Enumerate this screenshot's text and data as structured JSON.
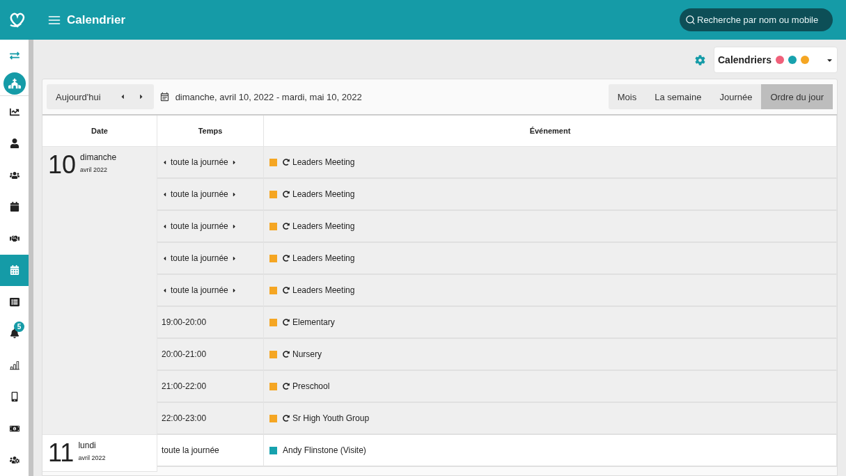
{
  "header": {
    "title": "Calendrier",
    "search": {
      "placeholder": "Recherche par nom ou mobile"
    }
  },
  "sidebar": {
    "items": [
      {
        "selected": false
      },
      {
        "kind": "avatar",
        "selected": false
      },
      {
        "selected": false
      },
      {
        "selected": false
      },
      {
        "selected": false
      },
      {
        "selected": false
      },
      {
        "selected": false
      },
      {
        "selected": true
      },
      {
        "selected": false
      },
      {
        "selected": false,
        "badge": "5"
      },
      {
        "selected": false
      },
      {
        "selected": false
      },
      {
        "selected": false
      },
      {
        "selected": false
      }
    ]
  },
  "calendars": {
    "label": "Calendriers",
    "dots": [
      {
        "color": "#f0607a"
      },
      {
        "color": "#17a2ae"
      },
      {
        "color": "#f5a623"
      }
    ]
  },
  "toolbar": {
    "today": "Aujourd'hui",
    "range": "dimanche, avril 10, 2022 - mardi, mai 10, 2022",
    "views": [
      {
        "label": "Mois",
        "selected": false
      },
      {
        "label": "La semaine",
        "selected": false
      },
      {
        "label": "Journée",
        "selected": false
      },
      {
        "label": "Ordre du jour",
        "selected": true
      }
    ]
  },
  "table": {
    "columns": [
      "Date",
      "Temps",
      "Événement"
    ],
    "days": [
      {
        "day": "10",
        "weekday": "dimanche",
        "month": "avril 2022",
        "highlighted": true,
        "events": [
          {
            "time": "toute la journée",
            "continues": true,
            "title": "Leaders Meeting",
            "recurring": true,
            "color": "#f5a623"
          },
          {
            "time": "toute la journée",
            "continues": true,
            "title": "Leaders Meeting",
            "recurring": true,
            "color": "#f5a623"
          },
          {
            "time": "toute la journée",
            "continues": true,
            "title": "Leaders Meeting",
            "recurring": true,
            "color": "#f5a623"
          },
          {
            "time": "toute la journée",
            "continues": true,
            "title": "Leaders Meeting",
            "recurring": true,
            "color": "#f5a623"
          },
          {
            "time": "toute la journée",
            "continues": true,
            "title": "Leaders Meeting",
            "recurring": true,
            "color": "#f5a623"
          },
          {
            "time": "19:00-20:00",
            "continues": false,
            "title": "Elementary",
            "recurring": true,
            "color": "#f5a623"
          },
          {
            "time": "20:00-21:00",
            "continues": false,
            "title": "Nursery",
            "recurring": true,
            "color": "#f5a623"
          },
          {
            "time": "21:00-22:00",
            "continues": false,
            "title": "Preschool",
            "recurring": true,
            "color": "#f5a623"
          },
          {
            "time": "22:00-23:00",
            "continues": false,
            "title": "Sr High Youth Group",
            "recurring": true,
            "color": "#f5a623"
          }
        ]
      },
      {
        "day": "11",
        "weekday": "lundi",
        "month": "avril 2022",
        "highlighted": false,
        "events": [
          {
            "time": "toute la journée",
            "continues": false,
            "title": "Andy Flinstone (Visite)",
            "recurring": false,
            "color": "#17a2ae"
          }
        ]
      }
    ]
  }
}
